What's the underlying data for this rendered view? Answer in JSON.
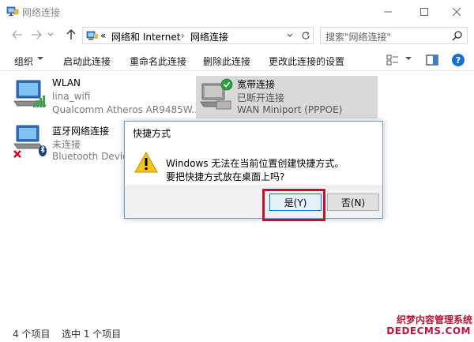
{
  "window": {
    "title": "网络连接"
  },
  "nav": {
    "path_prefix": "«",
    "breadcrumb": [
      {
        "label": "网络和 Internet"
      },
      {
        "label": "网络连接"
      }
    ],
    "separator": "›",
    "search_placeholder": "搜索\"网络连接\""
  },
  "toolbar": {
    "organize": "组织",
    "commands": [
      "启动此连接",
      "重命名此连接",
      "删除此连接",
      "更改此连接的设置"
    ]
  },
  "items": [
    {
      "name": "WLAN",
      "line2": "lina_wifi",
      "line3": "Qualcomm Atheros AR9485W...",
      "icon": "wifi-adapter-icon"
    },
    {
      "name": "宽带连接",
      "line2": "已断开连接",
      "line3": "WAN Miniport (PPPOE)",
      "icon": "broadband-icon"
    },
    {
      "name": "蓝牙网络连接",
      "line2": "未连接",
      "line3": "Bluetooth Device",
      "icon": "bluetooth-adapter-icon"
    }
  ],
  "dialog": {
    "title": "快捷方式",
    "message_line1": "Windows 无法在当前位置创建快捷方式。",
    "message_line2": "要把快捷方式放在桌面上吗?",
    "yes_label": "是(Y)",
    "no_label": "否(N)"
  },
  "status": {
    "count": "4 个项目",
    "selected": "选中 1 个项目"
  },
  "watermark": {
    "line1": "织梦内容管理系统",
    "line2": "DEDECMS.COM"
  },
  "colors": {
    "accent": "#0078d7",
    "highlight": "#c8102e",
    "selected_bg": "#d9d9d9",
    "help": "#1a6fc9"
  }
}
